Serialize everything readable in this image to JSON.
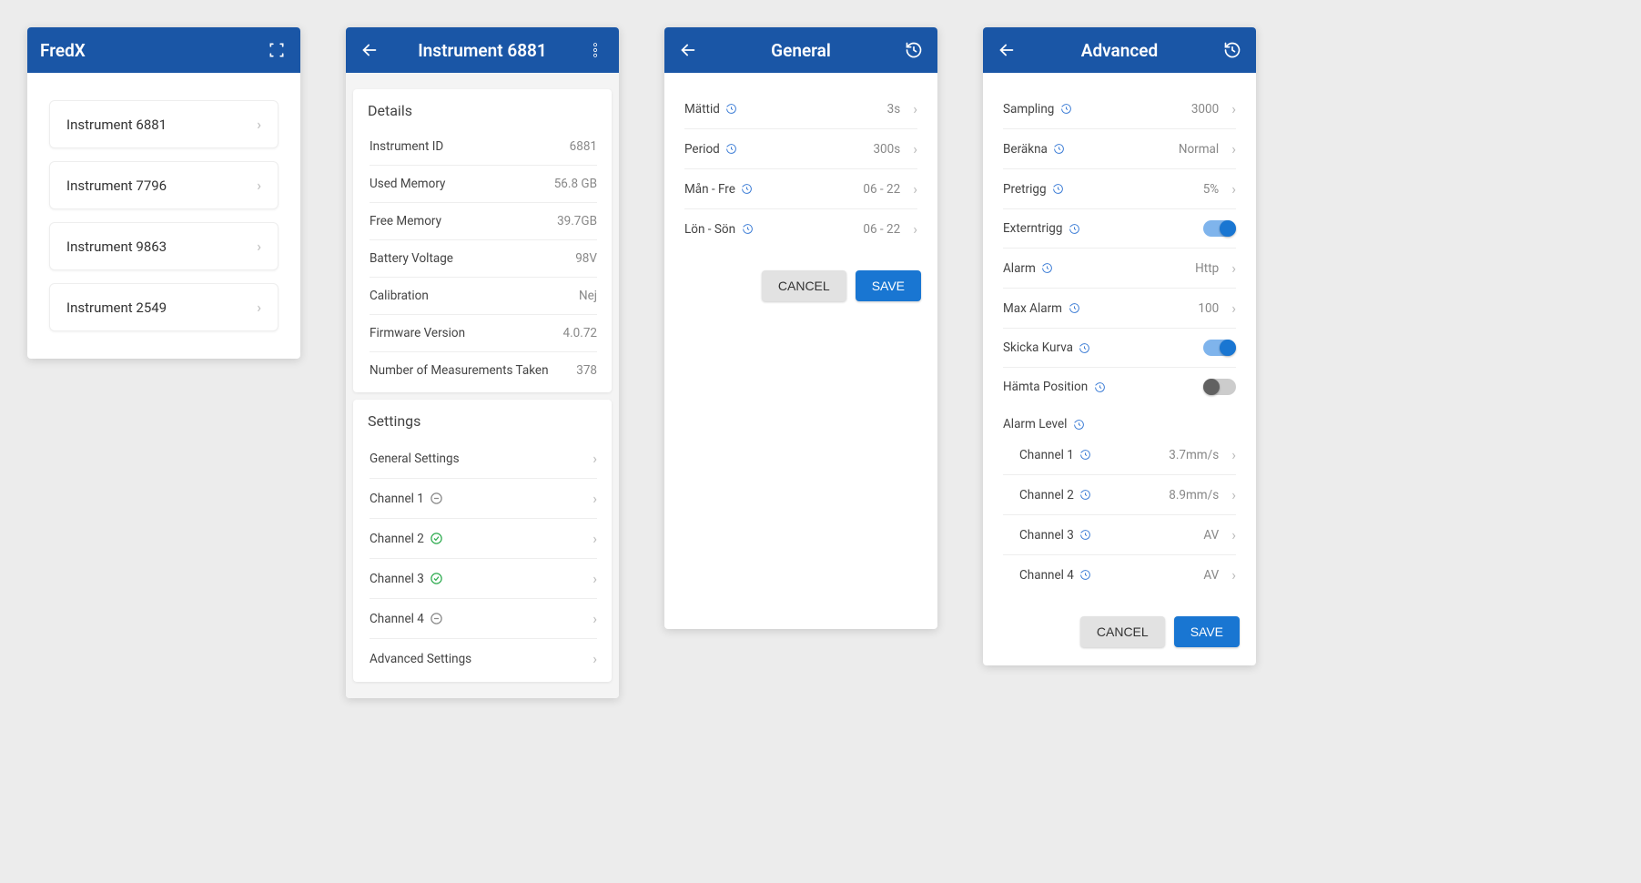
{
  "screen1": {
    "title": "FredX",
    "instruments": [
      {
        "label": "Instrument 6881"
      },
      {
        "label": "Instrument 7796"
      },
      {
        "label": "Instrument 9863"
      },
      {
        "label": "Instrument 2549"
      }
    ]
  },
  "screen2": {
    "title": "Instrument 6881",
    "details_title": "Details",
    "details": [
      {
        "label": "Instrument ID",
        "value": "6881"
      },
      {
        "label": "Used Memory",
        "value": "56.8 GB"
      },
      {
        "label": "Free Memory",
        "value": "39.7GB"
      },
      {
        "label": "Battery Voltage",
        "value": "98V"
      },
      {
        "label": "Calibration",
        "value": "Nej"
      },
      {
        "label": "Firmware Version",
        "value": "4.0.72"
      },
      {
        "label": "Number of Measurements Taken",
        "value": "378"
      }
    ],
    "settings_title": "Settings",
    "settings": [
      {
        "label": "General Settings",
        "status": null
      },
      {
        "label": "Channel 1",
        "status": "neutral"
      },
      {
        "label": "Channel 2",
        "status": "ok"
      },
      {
        "label": "Channel 3",
        "status": "ok"
      },
      {
        "label": "Channel 4",
        "status": "neutral"
      },
      {
        "label": "Advanced Settings",
        "status": null
      }
    ]
  },
  "screen3": {
    "title": "General",
    "items": [
      {
        "label": "Mättid",
        "value": "3s"
      },
      {
        "label": "Period",
        "value": "300s"
      },
      {
        "label": "Mån - Fre",
        "value": "06 - 22"
      },
      {
        "label": "Lön - Sön",
        "value": "06 - 22"
      }
    ],
    "cancel": "CANCEL",
    "save": "SAVE"
  },
  "screen4": {
    "title": "Advanced",
    "items": [
      {
        "label": "Sampling",
        "type": "nav",
        "value": "3000"
      },
      {
        "label": "Beräkna",
        "type": "nav",
        "value": "Normal"
      },
      {
        "label": "Pretrigg",
        "type": "nav",
        "value": "5%"
      },
      {
        "label": "Externtrigg",
        "type": "switch",
        "on": true
      },
      {
        "label": "Alarm",
        "type": "nav",
        "value": "Http"
      },
      {
        "label": "Max Alarm",
        "type": "nav",
        "value": "100"
      },
      {
        "label": "Skicka Kurva",
        "type": "switch",
        "on": true
      },
      {
        "label": "Hämta Position",
        "type": "switch",
        "on": false
      }
    ],
    "alarm_level_label": "Alarm Level",
    "alarm_levels": [
      {
        "label": "Channel 1",
        "value": "3.7mm/s"
      },
      {
        "label": "Channel 2",
        "value": "8.9mm/s"
      },
      {
        "label": "Channel 3",
        "value": "AV"
      },
      {
        "label": "Channel 4",
        "value": "AV"
      }
    ],
    "cancel": "CANCEL",
    "save": "SAVE"
  }
}
